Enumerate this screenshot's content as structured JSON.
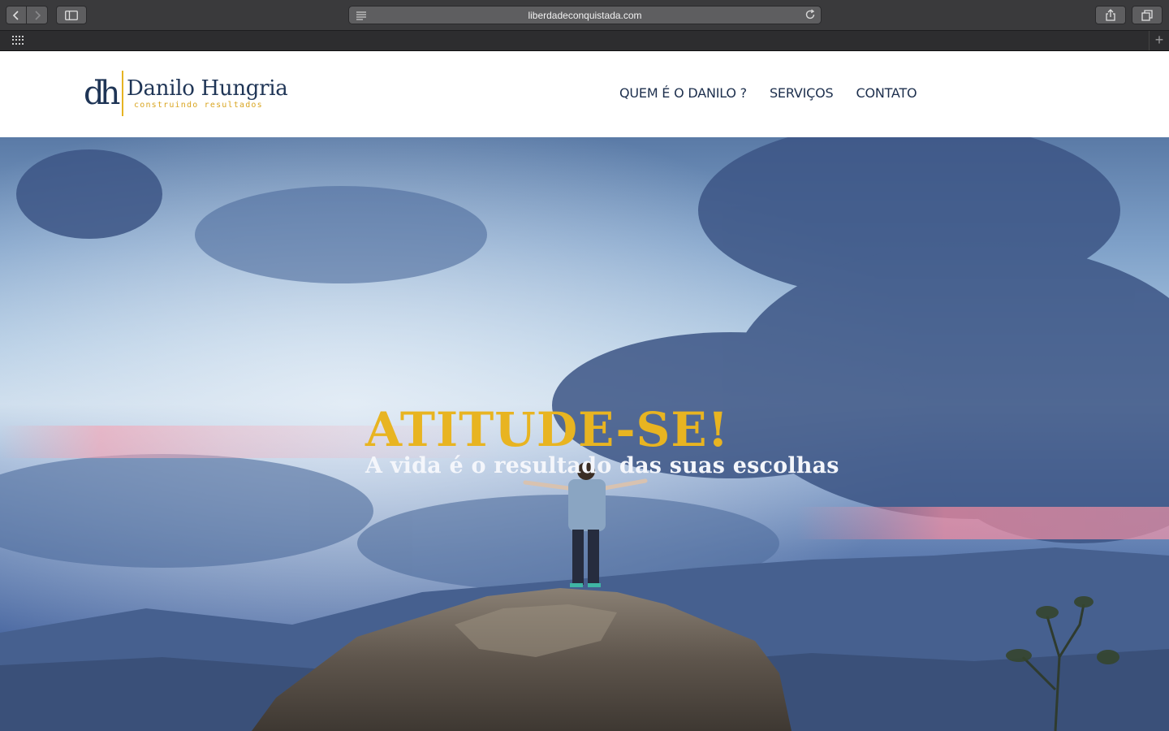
{
  "browser": {
    "url": "liberdadeconquistada.com",
    "icons": {
      "back": "chevron-left-icon",
      "forward": "chevron-right-icon",
      "sidebar": "sidebar-icon",
      "reader": "reader-icon",
      "reload": "reload-icon",
      "share": "share-icon",
      "tabs": "tabs-icon",
      "favorites": "grid-icon",
      "new_tab": "plus-icon"
    },
    "new_tab_label": "+"
  },
  "header": {
    "logo": {
      "mark": "dh",
      "name": "Danilo Hungria",
      "tagline": "construindo resultados"
    },
    "nav": [
      {
        "label": "QUEM É O DANILO ?"
      },
      {
        "label": "SERVIÇOS"
      },
      {
        "label": "CONTATO"
      }
    ]
  },
  "hero": {
    "title": "ATITUDE-SE!",
    "subtitle": "A vida é o resultado das suas escolhas"
  },
  "colors": {
    "brand_navy": "#1f3556",
    "brand_gold": "#e6b422",
    "hero_title": "#e8b421",
    "hero_subtitle": "#f4f6fb"
  }
}
